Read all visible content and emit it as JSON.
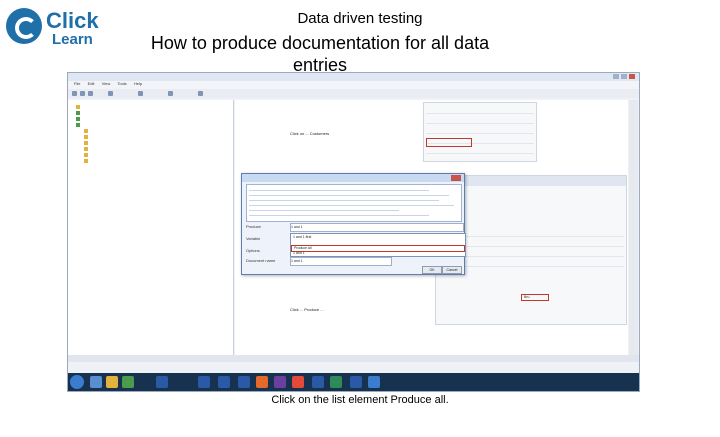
{
  "logo": {
    "word1": "Click",
    "word2": "Learn"
  },
  "slide": {
    "title_line1": "Data driven testing",
    "title_line2": "How to produce documentation for all data entries",
    "caption": "Click on the list element Produce all."
  },
  "window": {
    "menu": [
      "File",
      "Edit",
      "View",
      "Tools",
      "Help"
    ]
  },
  "doc": {
    "step1_text": "Click on ... Customers",
    "step2_text": "Click ... Produce ...",
    "field_value": "Bru"
  },
  "dialog": {
    "label_produce": "Produce",
    "label_variable": "Variable",
    "label_options": "Options",
    "label_document": "Document name",
    "value_document": "1 and 1",
    "value_selected": "1 and 1 ",
    "list_items": [
      "1 and 1 first",
      "Produce all",
      "1 and 1"
    ],
    "ok_label": "OK",
    "cancel_label": "Cancel"
  },
  "colors": {
    "brand": "#1f6fa8",
    "highlight_red": "#c0392b",
    "dialog_border": "#5b7db4",
    "taskbar": "#16324f"
  }
}
